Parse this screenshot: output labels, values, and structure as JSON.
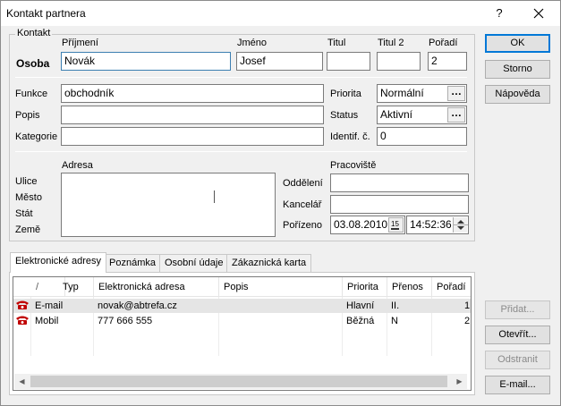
{
  "window": {
    "title": "Kontakt partnera",
    "help_glyph": "?",
    "close_glyph": "✕"
  },
  "kontakt": {
    "legend": "Kontakt",
    "row_label": "Osoba",
    "prijmeni": {
      "label": "Příjmení",
      "value": "Novák"
    },
    "jmeno": {
      "label": "Jméno",
      "value": "Josef"
    },
    "titul": {
      "label": "Titul",
      "value": ""
    },
    "titul2": {
      "label": "Titul 2",
      "value": ""
    },
    "poradi": {
      "label": "Pořadí",
      "value": "2"
    },
    "funkce": {
      "label": "Funkce",
      "value": "obchodník"
    },
    "popis": {
      "label": "Popis",
      "value": ""
    },
    "kategorie": {
      "label": "Kategorie",
      "value": ""
    },
    "priorita": {
      "label": "Priorita",
      "value": "Normální"
    },
    "status": {
      "label": "Status",
      "value": "Aktivní"
    },
    "identif": {
      "label": "Identif. č.",
      "value": "0"
    },
    "dots": "…",
    "adresa": {
      "label": "Adresa",
      "ulice": "Ulice",
      "mesto": "Město",
      "stat": "Stát",
      "zeme": "Země"
    },
    "pracoviste": {
      "label": "Pracoviště"
    },
    "oddeleni": {
      "label": "Oddělení",
      "value": ""
    },
    "kancelar": {
      "label": "Kancelář",
      "value": ""
    },
    "porizeno": {
      "label": "Pořízeno",
      "date": "03.08.2010",
      "time": "14:52:36",
      "cal_glyph": "15"
    }
  },
  "buttons": {
    "ok": "OK",
    "storno": "Storno",
    "napoveda": "Nápověda",
    "pridat": "Přidat...",
    "otevrit": "Otevřít...",
    "odstranit": "Odstranit",
    "email": "E-mail..."
  },
  "tabs": [
    {
      "label": "Elektronické adresy"
    },
    {
      "label": "Poznámka"
    },
    {
      "label": "Osobní údaje"
    },
    {
      "label": "Zákaznická karta"
    }
  ],
  "grid": {
    "columns": [
      "/",
      "Typ",
      "Elektronická adresa",
      "Popis",
      "Priorita",
      "Přenos",
      "Pořadí"
    ],
    "rows": [
      {
        "typ": "E-mail",
        "adresa": "novak@abtrefa.cz",
        "popis": "",
        "priorita": "Hlavní",
        "prenos": "II.",
        "poradi": "1",
        "icon": "phone-icon"
      },
      {
        "typ": "Mobil",
        "adresa": "777 666 555",
        "popis": "",
        "priorita": "Běžná",
        "prenos": "N",
        "poradi": "2",
        "icon": "phone-icon"
      }
    ],
    "icon_color": "#c00000"
  },
  "colors": {
    "focus_border": "#3c7fb1",
    "default_button_border": "#0078d7",
    "selected_row": "#e5e5e5"
  }
}
